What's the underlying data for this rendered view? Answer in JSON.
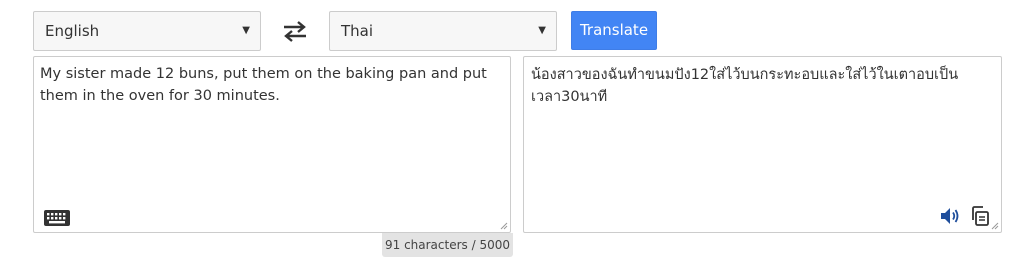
{
  "source_language": {
    "selected": "English"
  },
  "target_language": {
    "selected": "Thai"
  },
  "translate_button": {
    "label": "Translate"
  },
  "source_text": "My sister made 12 buns, put them on the baking pan and put them in the oven for 30 minutes.",
  "translated_text": "น้องสาวของฉันทำขนมปัง12ใส่ไว้บนกระทะอบและใส่ไว้ในเตาอบเป็นเวลา30นาที",
  "character_counter": "91 characters / 5000",
  "icons": {
    "swap": "swap-arrows-icon",
    "keyboard": "keyboard-icon",
    "speaker": "speaker-icon",
    "copy": "copy-icon",
    "dropdown": "chevron-down-icon"
  },
  "colors": {
    "accent": "#4285f4",
    "icon_blue": "#1f4e9c"
  }
}
